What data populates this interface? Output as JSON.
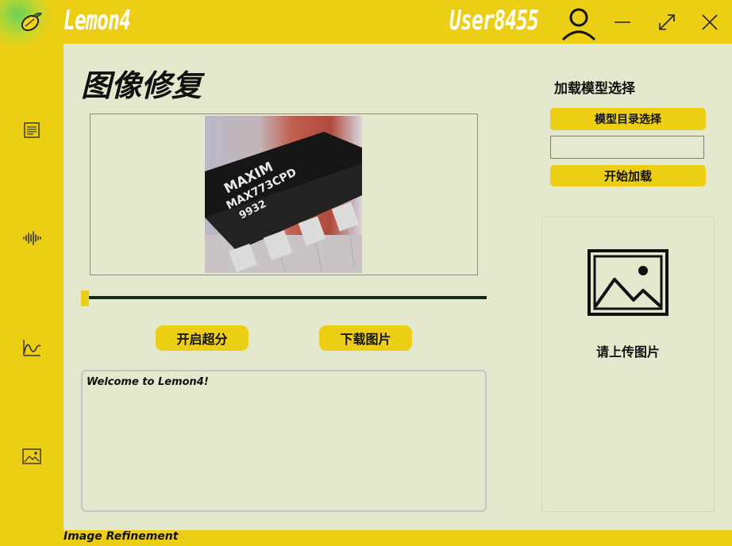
{
  "window": {
    "app_title": "Lemon4",
    "username": "User8455",
    "controls": [
      "minimize-icon",
      "maximize-icon",
      "close-icon"
    ]
  },
  "sidebar": {
    "items": [
      {
        "icon": "document-icon"
      },
      {
        "icon": "audio-wave-icon"
      },
      {
        "icon": "waveform-icon"
      },
      {
        "icon": "image-icon"
      }
    ]
  },
  "main": {
    "page_title": "图像修复",
    "preview_image": "ic-chip-maxim-image",
    "slider_value": 0,
    "buttons": {
      "super_res": "开启超分",
      "download": "下载图片"
    },
    "log_text": "Welcome to Lemon4!"
  },
  "model": {
    "section_title": "加载模型选择",
    "choose_dir_label": "模型目录选择",
    "dir_value": "",
    "load_label": "开始加载"
  },
  "upload": {
    "text": "请上传图片"
  },
  "status_bar": {
    "text": "Image Refinement"
  },
  "colors": {
    "accent": "#ecce14",
    "background": "#e4e8cd",
    "slider_track": "#142814"
  }
}
